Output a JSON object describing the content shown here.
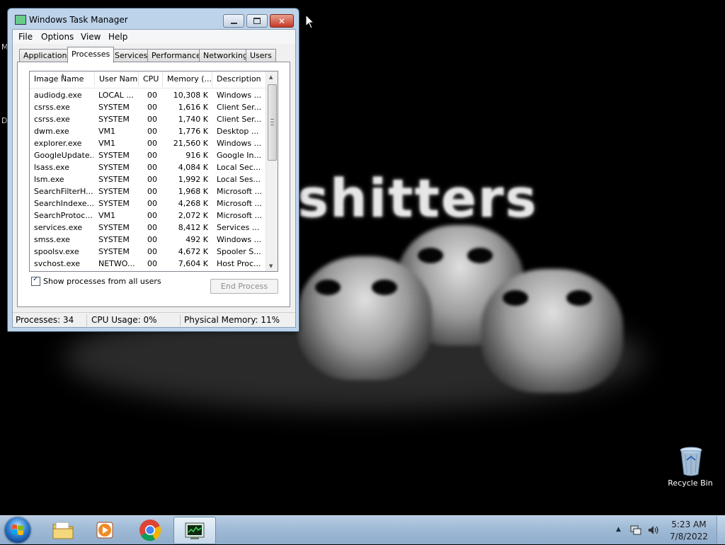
{
  "desktop": {
    "wallpaper_text": "shitters",
    "edge_letters": [
      "M",
      "D"
    ],
    "icons": [
      {
        "label": "Recycle Bin",
        "icon": "recycle-bin-icon"
      }
    ]
  },
  "task_manager": {
    "title": "Windows Task Manager",
    "menu": [
      "File",
      "Options",
      "View",
      "Help"
    ],
    "tabs": [
      "Applications",
      "Processes",
      "Services",
      "Performance",
      "Networking",
      "Users"
    ],
    "active_tab": "Processes",
    "columns": [
      "Image Name",
      "User Name",
      "CPU",
      "Memory (...",
      "Description"
    ],
    "processes": [
      {
        "image": "audiodg.exe",
        "user": "LOCAL ...",
        "cpu": "00",
        "memory": "10,308 K",
        "description": "Windows ..."
      },
      {
        "image": "csrss.exe",
        "user": "SYSTEM",
        "cpu": "00",
        "memory": "1,616 K",
        "description": "Client Ser..."
      },
      {
        "image": "csrss.exe",
        "user": "SYSTEM",
        "cpu": "00",
        "memory": "1,740 K",
        "description": "Client Ser..."
      },
      {
        "image": "dwm.exe",
        "user": "VM1",
        "cpu": "00",
        "memory": "1,776 K",
        "description": "Desktop ..."
      },
      {
        "image": "explorer.exe",
        "user": "VM1",
        "cpu": "00",
        "memory": "21,560 K",
        "description": "Windows ..."
      },
      {
        "image": "GoogleUpdate...",
        "user": "SYSTEM",
        "cpu": "00",
        "memory": "916 K",
        "description": "Google In..."
      },
      {
        "image": "lsass.exe",
        "user": "SYSTEM",
        "cpu": "00",
        "memory": "4,084 K",
        "description": "Local Sec..."
      },
      {
        "image": "lsm.exe",
        "user": "SYSTEM",
        "cpu": "00",
        "memory": "1,992 K",
        "description": "Local Ses..."
      },
      {
        "image": "SearchFilterH...",
        "user": "SYSTEM",
        "cpu": "00",
        "memory": "1,968 K",
        "description": "Microsoft ..."
      },
      {
        "image": "SearchIndexe...",
        "user": "SYSTEM",
        "cpu": "00",
        "memory": "4,268 K",
        "description": "Microsoft ..."
      },
      {
        "image": "SearchProtoc...",
        "user": "VM1",
        "cpu": "00",
        "memory": "2,072 K",
        "description": "Microsoft ..."
      },
      {
        "image": "services.exe",
        "user": "SYSTEM",
        "cpu": "00",
        "memory": "8,412 K",
        "description": "Services ..."
      },
      {
        "image": "smss.exe",
        "user": "SYSTEM",
        "cpu": "00",
        "memory": "492 K",
        "description": "Windows ..."
      },
      {
        "image": "spoolsv.exe",
        "user": "SYSTEM",
        "cpu": "00",
        "memory": "4,672 K",
        "description": "Spooler S..."
      },
      {
        "image": "svchost.exe",
        "user": "NETWO...",
        "cpu": "00",
        "memory": "7,604 K",
        "description": "Host Proc..."
      }
    ],
    "show_all_label": "Show processes from all users",
    "show_all_checked": true,
    "end_process_label": "End Process",
    "status": {
      "processes": "Processes: 34",
      "cpu": "CPU Usage: 0%",
      "memory": "Physical Memory: 11%"
    }
  },
  "taskbar": {
    "pinned": [
      "folder-icon",
      "media-player-icon",
      "chrome-icon",
      "task-manager-icon"
    ],
    "active_app": "task-manager-icon",
    "clock_time": "5:23 AM",
    "clock_date": "7/8/2022"
  }
}
